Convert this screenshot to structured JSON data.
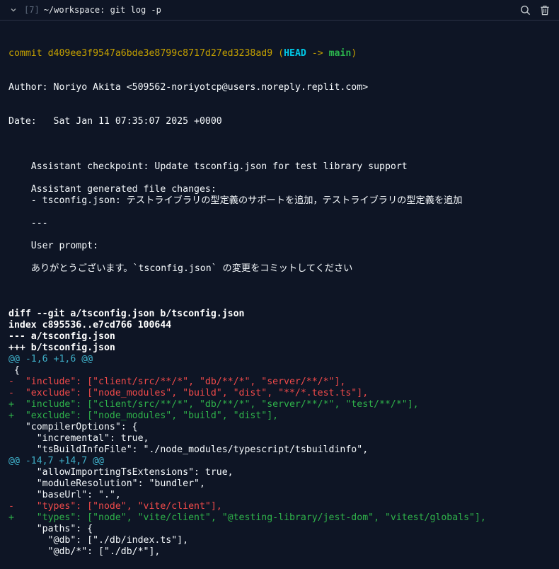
{
  "header": {
    "tab_number": "[7]",
    "title": "~/workspace: git log -p"
  },
  "commit": {
    "prefix": "commit ",
    "hash": "d409ee3f9547a6bde3e8799c8717d27ed3238ad9",
    "ref_open": " (",
    "head": "HEAD",
    "arrow": " -> ",
    "branch": "main",
    "ref_close": ")",
    "author": "Author: Noriyo Akita <509562-noriyotcp@users.noreply.replit.com>",
    "date": "Date:   Sat Jan 11 07:35:07 2025 +0000"
  },
  "message": [
    "",
    "    Assistant checkpoint: Update tsconfig.json for test library support",
    "",
    "    Assistant generated file changes:",
    "    - tsconfig.json: テストライブラリの型定義のサポートを追加，テストライブラリの型定義を追加",
    "",
    "    ---",
    "",
    "    User prompt:",
    "",
    "    ありがとうございます。`tsconfig.json` の変更をコミットしてください",
    ""
  ],
  "diff_header": [
    "diff --git a/tsconfig.json b/tsconfig.json",
    "index c895536..e7cd766 100644",
    "--- a/tsconfig.json",
    "+++ b/tsconfig.json"
  ],
  "hunks": [
    {
      "header": "@@ -1,6 +1,6 @@",
      "lines": [
        {
          "type": "ctx",
          "text": " {"
        },
        {
          "type": "del",
          "text": "-  \"include\": [\"client/src/**/*\", \"db/**/*\", \"server/**/*\"],"
        },
        {
          "type": "del",
          "text": "-  \"exclude\": [\"node_modules\", \"build\", \"dist\", \"**/*.test.ts\"],"
        },
        {
          "type": "add",
          "text": "+  \"include\": [\"client/src/**/*\", \"db/**/*\", \"server/**/*\", \"test/**/*\"],"
        },
        {
          "type": "add",
          "text": "+  \"exclude\": [\"node_modules\", \"build\", \"dist\"],"
        },
        {
          "type": "ctx",
          "text": "   \"compilerOptions\": {"
        },
        {
          "type": "ctx",
          "text": "     \"incremental\": true,"
        },
        {
          "type": "ctx",
          "text": "     \"tsBuildInfoFile\": \"./node_modules/typescript/tsbuildinfo\","
        }
      ]
    },
    {
      "header": "@@ -14,7 +14,7 @@",
      "lines": [
        {
          "type": "ctx",
          "text": "     \"allowImportingTsExtensions\": true,"
        },
        {
          "type": "ctx",
          "text": "     \"moduleResolution\": \"bundler\","
        },
        {
          "type": "ctx",
          "text": "     \"baseUrl\": \".\","
        },
        {
          "type": "del",
          "text": "-    \"types\": [\"node\", \"vite/client\"],"
        },
        {
          "type": "add",
          "text": "+    \"types\": [\"node\", \"vite/client\", \"@testing-library/jest-dom\", \"vitest/globals\"],"
        },
        {
          "type": "ctx",
          "text": "     \"paths\": {"
        },
        {
          "type": "ctx",
          "text": "       \"@db\": [\"./db/index.ts\"],"
        },
        {
          "type": "ctx",
          "text": "       \"@db/*\": [\"./db/*\"],"
        }
      ]
    }
  ],
  "colors": {
    "background": "#0e1525",
    "commit_hash": "#c4a000",
    "head_ref": "#00c8e6",
    "branch_ref": "#2bb24c",
    "hunk_header": "#3fb0c9",
    "deleted": "#f04a4a",
    "added": "#2fb24a"
  },
  "icons": {
    "collapse": "chevron-down-icon",
    "search": "search-icon",
    "clear": "trash-icon"
  }
}
